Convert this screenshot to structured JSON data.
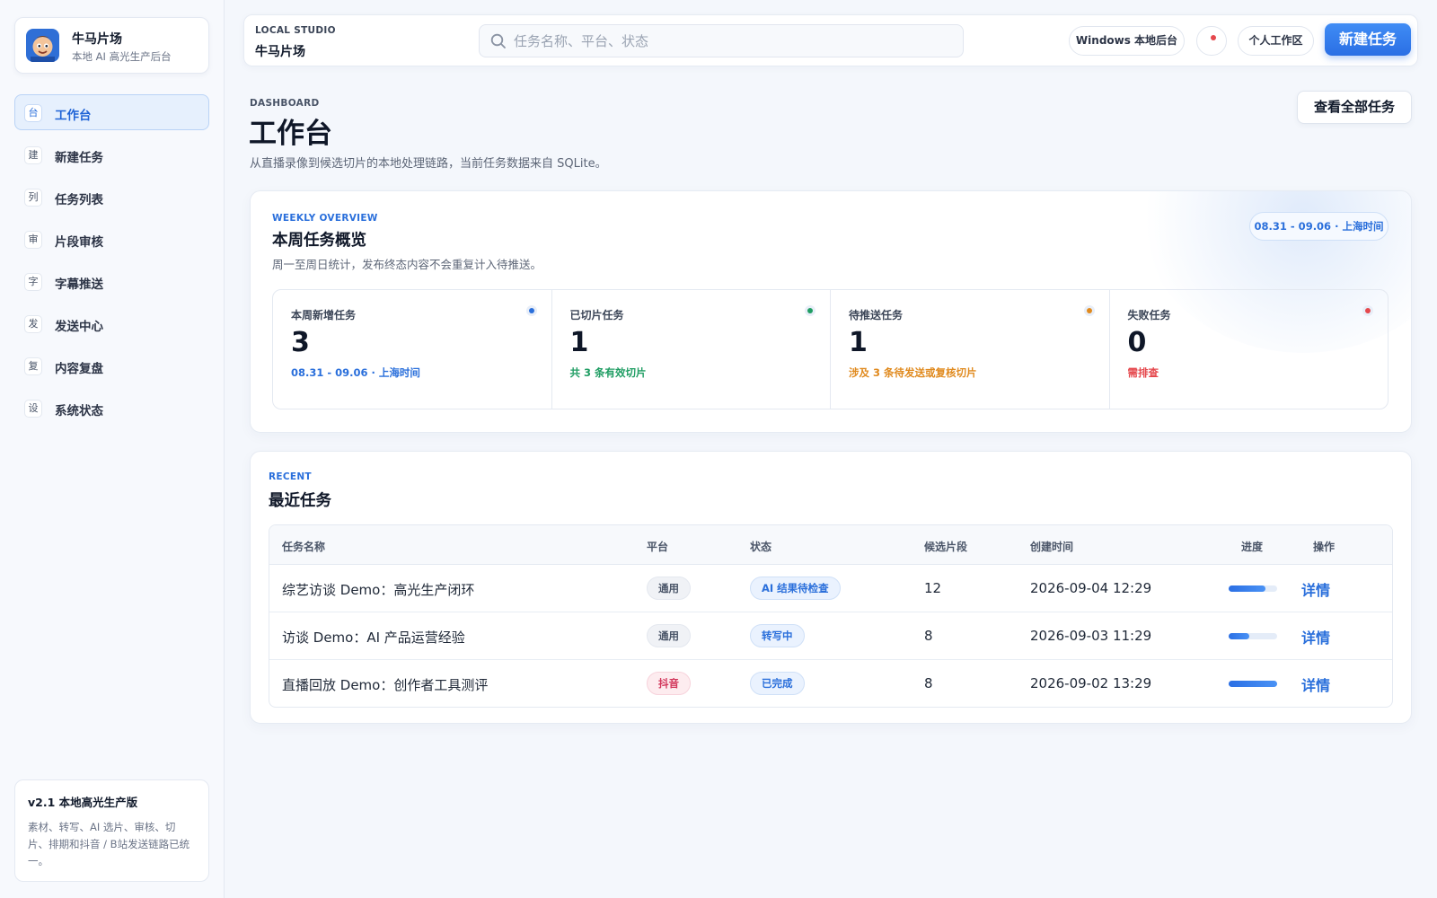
{
  "brand": {
    "name": "牛马片场",
    "subtitle": "本地 AI 高光生产后台"
  },
  "nav": [
    {
      "icon": "台",
      "label": "工作台",
      "active": true
    },
    {
      "icon": "建",
      "label": "新建任务"
    },
    {
      "icon": "列",
      "label": "任务列表"
    },
    {
      "icon": "审",
      "label": "片段审核"
    },
    {
      "icon": "字",
      "label": "字幕推送"
    },
    {
      "icon": "发",
      "label": "发送中心"
    },
    {
      "icon": "复",
      "label": "内容复盘"
    },
    {
      "icon": "设",
      "label": "系统状态"
    }
  ],
  "version": {
    "title": "v2.1 本地高光生产版",
    "desc": "素材、转写、AI 选片、审核、切片、排期和抖音 / B站发送链路已统一。"
  },
  "topbar": {
    "kicker": "LOCAL STUDIO",
    "studio": "牛马片场",
    "search_placeholder": "任务名称、平台、状态",
    "windows_label": "Windows 本地后台",
    "personal_label": "个人工作区",
    "new_task_label": "新建任务"
  },
  "page": {
    "kicker": "DASHBOARD",
    "title": "工作台",
    "desc": "从直播录像到候选切片的本地处理链路，当前任务数据来自 SQLite。",
    "view_all": "查看全部任务"
  },
  "weekly": {
    "kicker": "WEEKLY OVERVIEW",
    "title": "本周任务概览",
    "desc": "周一至周日统计，发布终态内容不会重复计入待推送。",
    "date_range": "08.31 - 09.06 · 上海时间",
    "stats": [
      {
        "label": "本周新增任务",
        "value": "3",
        "note": "08.31 - 09.06 · 上海时间",
        "color": "#2a6fdb"
      },
      {
        "label": "已切片任务",
        "value": "1",
        "note": "共 3 条有效切片",
        "color": "#1f9d63"
      },
      {
        "label": "待推送任务",
        "value": "1",
        "note": "涉及 3 条待发送或复核切片",
        "color": "#e08a1e"
      },
      {
        "label": "失败任务",
        "value": "0",
        "note": "需排查",
        "color": "#e5484d"
      }
    ]
  },
  "recent": {
    "kicker": "RECENT",
    "title": "最近任务",
    "columns": {
      "name": "任务名称",
      "platform": "平台",
      "status": "状态",
      "candidates": "候选片段",
      "created": "创建时间",
      "progress": "进度",
      "action": "操作"
    },
    "rows": [
      {
        "name": "综艺访谈 Demo：高光生产闭环",
        "platform": "通用",
        "status": "AI 结果待检查",
        "candidates": "12",
        "created": "2026-09-04 12:29",
        "progress": 0.75,
        "action": "详情"
      },
      {
        "name": "访谈 Demo：AI 产品运营经验",
        "platform": "通用",
        "status": "转写中",
        "candidates": "8",
        "created": "2026-09-03 11:29",
        "progress": 0.42,
        "action": "详情"
      },
      {
        "name": "直播回放 Demo：创作者工具测评",
        "platform": "抖音",
        "status": "已完成",
        "candidates": "8",
        "created": "2026-09-02 13:29",
        "progress": 1.0,
        "action": "详情"
      }
    ]
  }
}
